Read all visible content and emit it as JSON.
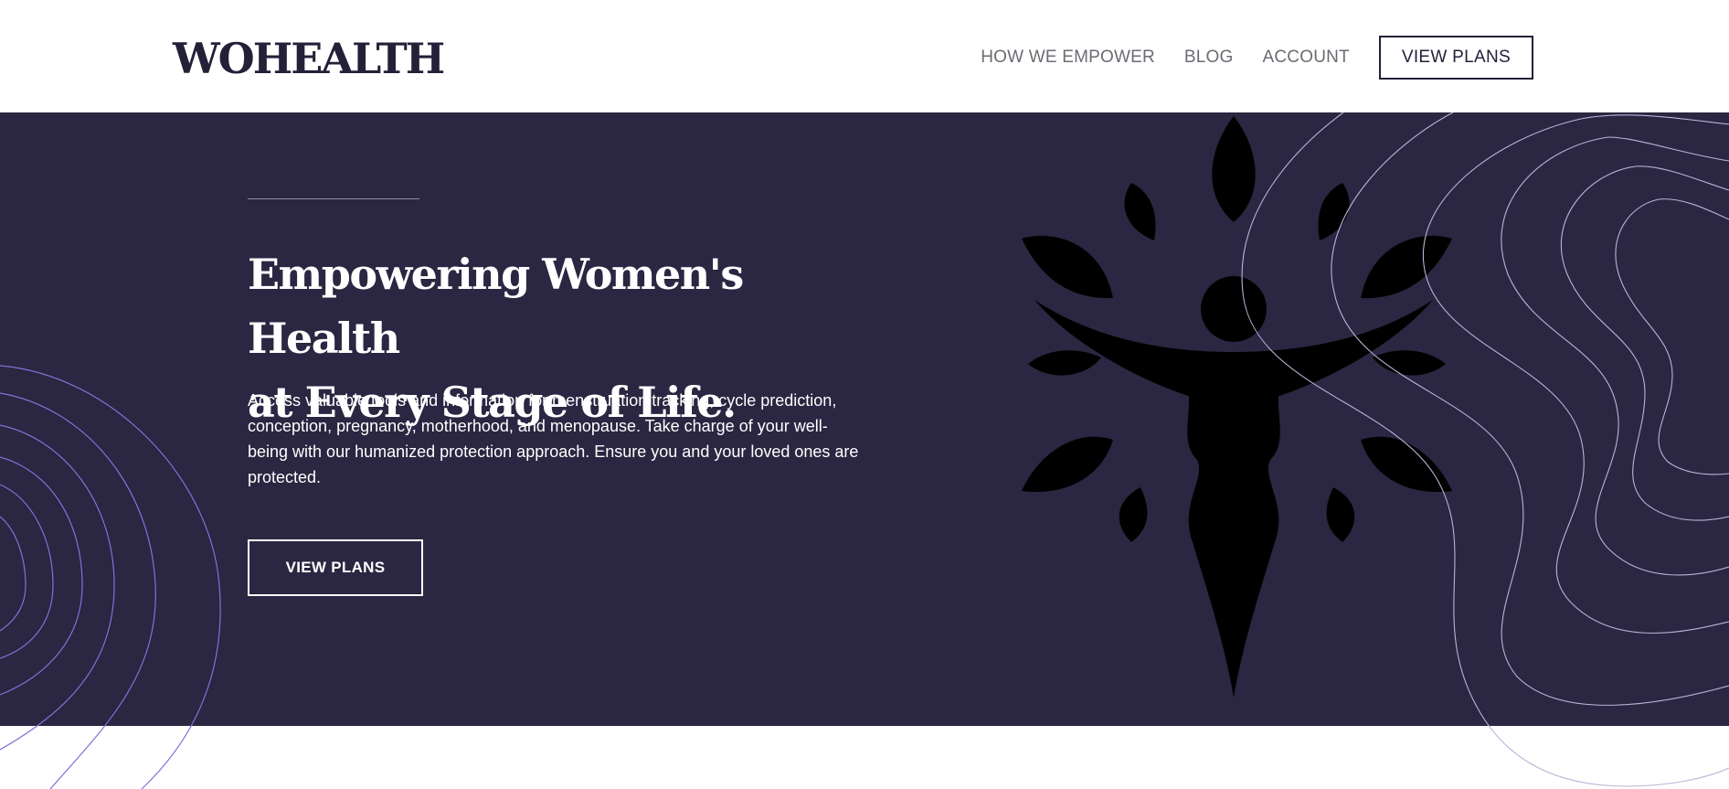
{
  "header": {
    "logo": "WOHEALTH",
    "nav": [
      {
        "label": "HOW WE EMPOWER"
      },
      {
        "label": "BLOG"
      },
      {
        "label": "ACCOUNT"
      }
    ],
    "cta_label": "VIEW PLANS"
  },
  "hero": {
    "title_line1": "Empowering Women's Health",
    "title_line2": "at Every Stage of Life.",
    "body": "Access valuable tools and information for menstruation tracking, cycle prediction, conception, pregnancy, motherhood, and menopause. Take charge of your well-being with our humanized protection approach. Ensure you and your loved ones are protected.",
    "cta_label": "VIEW PLANS"
  },
  "colors": {
    "navy": "#232138",
    "hero_bg": "#2b2641",
    "nav_text": "#6b6b73",
    "contour_left": "#7c74d8",
    "contour_right": "#b9b4d6"
  },
  "icons": {
    "figure": "woman-with-leaves-icon",
    "contours": "topographic-lines-decoration"
  }
}
